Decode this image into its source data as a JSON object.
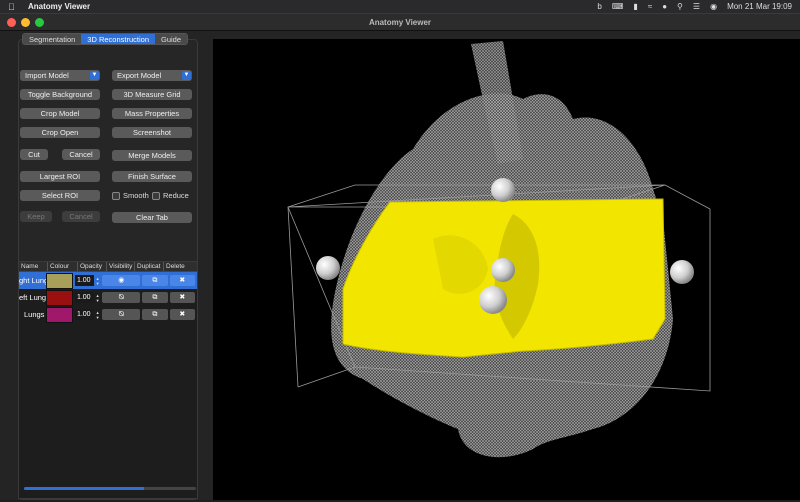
{
  "menubar": {
    "app_name": "Anatomy Viewer",
    "date_time": "Mon 21 Mar  19:09",
    "icons": [
      "bing-icon",
      "keyboard-icon",
      "battery-icon",
      "wifi-icon",
      "lock-icon",
      "search-icon",
      "control-center-icon",
      "user-icon"
    ]
  },
  "window": {
    "title": "Anatomy Viewer"
  },
  "tabs": [
    {
      "label": "Segmentation",
      "active": false
    },
    {
      "label": "3D Reconstruction",
      "active": true
    },
    {
      "label": "Guide",
      "active": false
    }
  ],
  "controls": {
    "import_model": "Import Model",
    "export_model": "Export Model",
    "toggle_background": "Toggle Background",
    "measure_grid": "3D Measure Grid",
    "crop_model": "Crop Model",
    "mass_properties": "Mass Properties",
    "crop_open": "Crop Open",
    "screenshot": "Screenshot",
    "cut": "Cut",
    "cancel": "Cancel",
    "merge_models": "Merge Models",
    "largest_roi": "Largest ROI",
    "finish_surface": "Finish Surface",
    "select_roi": "Select ROI",
    "smooth": "Smooth",
    "reduce": "Reduce",
    "keep": "Keep",
    "cancel2": "Cancel",
    "clear_tab": "Clear Tab"
  },
  "table": {
    "headers": [
      "Name",
      "Colour",
      "Opacity",
      "Visibility",
      "Duplicat",
      "Delete"
    ],
    "rows": [
      {
        "name": "ght Lung",
        "colour": "#a8a058",
        "opacity": "1.00",
        "visible": true,
        "selected": true
      },
      {
        "name": "eft Lung",
        "colour": "#9a1010",
        "opacity": "1.00",
        "visible": false,
        "selected": false
      },
      {
        "name": "Lungs",
        "colour": "#a0186a",
        "opacity": "1.00",
        "visible": false,
        "selected": false
      }
    ]
  },
  "progress": {
    "value": 0.7
  },
  "colors": {
    "accent": "#2f6fd6",
    "segment_yellow": "#f2e600",
    "viewport_bg": "#000000"
  }
}
